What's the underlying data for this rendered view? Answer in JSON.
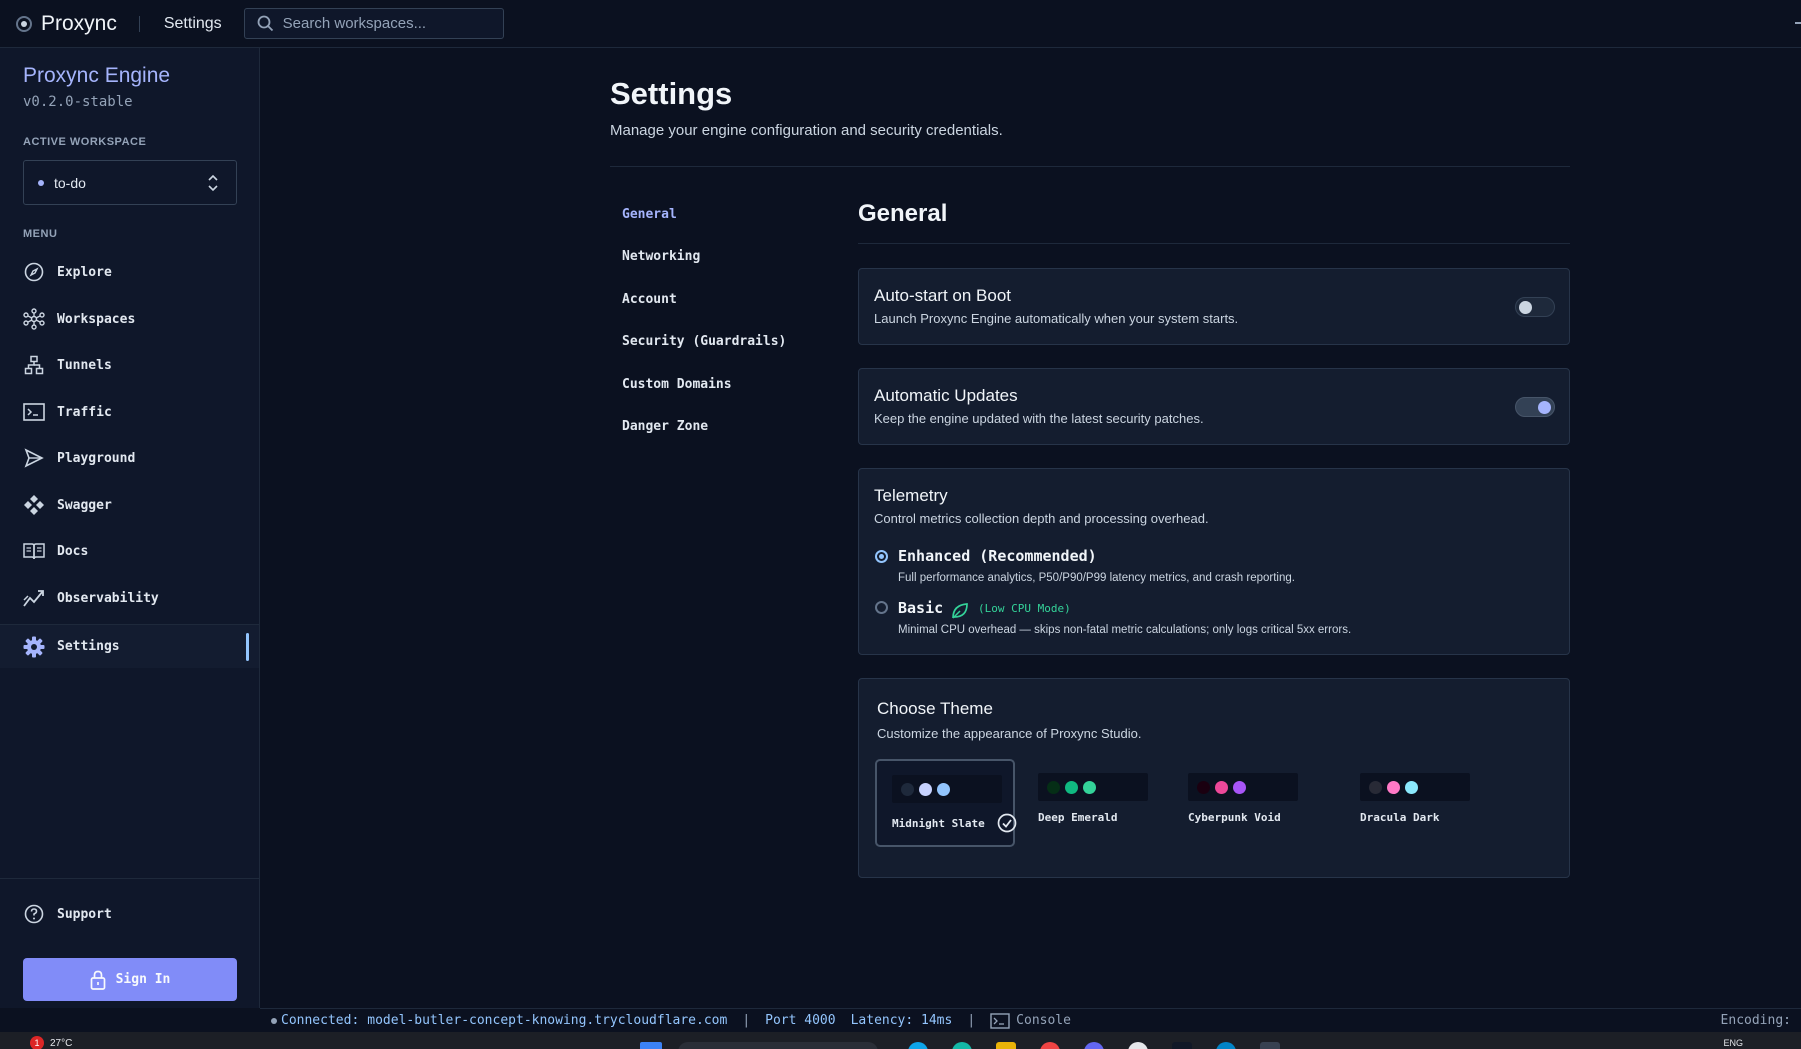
{
  "app": {
    "name": "Proxync",
    "current_page": "Settings"
  },
  "search": {
    "placeholder": "Search workspaces..."
  },
  "sidebar": {
    "engine_title": "Proxync Engine",
    "version": "v0.2.0-stable",
    "active_workspace_label": "ACTIVE WORKSPACE",
    "workspace": "to-do",
    "menu_label": "MENU",
    "items": [
      {
        "label": "Explore",
        "icon": "compass-icon"
      },
      {
        "label": "Workspaces",
        "icon": "network-icon"
      },
      {
        "label": "Tunnels",
        "icon": "sitemap-icon"
      },
      {
        "label": "Traffic",
        "icon": "terminal-icon"
      },
      {
        "label": "Playground",
        "icon": "send-icon"
      },
      {
        "label": "Swagger",
        "icon": "swagger-icon"
      },
      {
        "label": "Docs",
        "icon": "book-icon"
      },
      {
        "label": "Observability",
        "icon": "chart-line-icon"
      },
      {
        "label": "Settings",
        "icon": "gear-icon"
      }
    ],
    "active_item": "Settings",
    "support": "Support",
    "sign_in": "Sign In"
  },
  "page": {
    "title": "Settings",
    "subtitle": "Manage your engine configuration and security credentials."
  },
  "subnav": {
    "items": [
      "General",
      "Networking",
      "Account",
      "Security (Guardrails)",
      "Custom Domains",
      "Danger Zone"
    ],
    "active": "General"
  },
  "general": {
    "title": "General",
    "autostart": {
      "title": "Auto-start on Boot",
      "desc": "Launch Proxync Engine automatically when your system starts.",
      "enabled": false
    },
    "updates": {
      "title": "Automatic Updates",
      "desc": "Keep the engine updated with the latest security patches.",
      "enabled": true
    },
    "telemetry": {
      "title": "Telemetry",
      "desc": "Control metrics collection depth and processing overhead.",
      "options": [
        {
          "title": "Enhanced (Recommended)",
          "desc": "Full performance analytics, P50/P90/P99 latency metrics, and crash reporting.",
          "selected": true
        },
        {
          "title": "Basic",
          "badge": "(Low CPU Mode)",
          "desc": "Minimal CPU overhead — skips non-fatal metric calculations; only logs critical 5xx errors.",
          "selected": false
        }
      ]
    },
    "theme": {
      "title": "Choose Theme",
      "desc": "Customize the appearance of Proxync Studio.",
      "selected": "Midnight Slate",
      "options": [
        {
          "name": "Midnight Slate",
          "colors": [
            "#1e293b",
            "#c7d2fe",
            "#93c5fd"
          ]
        },
        {
          "name": "Deep Emerald",
          "colors": [
            "#052e16",
            "#10b981",
            "#34d399"
          ]
        },
        {
          "name": "Cyberpunk Void",
          "colors": [
            "#1a0010",
            "#ec4899",
            "#a855f7"
          ]
        },
        {
          "name": "Dracula Dark",
          "colors": [
            "#282a36",
            "#ff79c6",
            "#8be9fd"
          ]
        }
      ]
    }
  },
  "status": {
    "connected_label": "Connected:",
    "host": "model-butler-concept-knowing.trycloudflare.com",
    "port": "Port 4000",
    "latency": "Latency: 14ms",
    "console": "Console",
    "encoding": "Encoding:"
  },
  "taskbar": {
    "notification_count": "1",
    "weather": "27°C",
    "lang": "ENG"
  },
  "colors": {
    "accent": "#818cf8",
    "accent_light": "#a5b4fc",
    "bg": "#0b1120",
    "card": "#141d2f",
    "success": "#34d399"
  }
}
